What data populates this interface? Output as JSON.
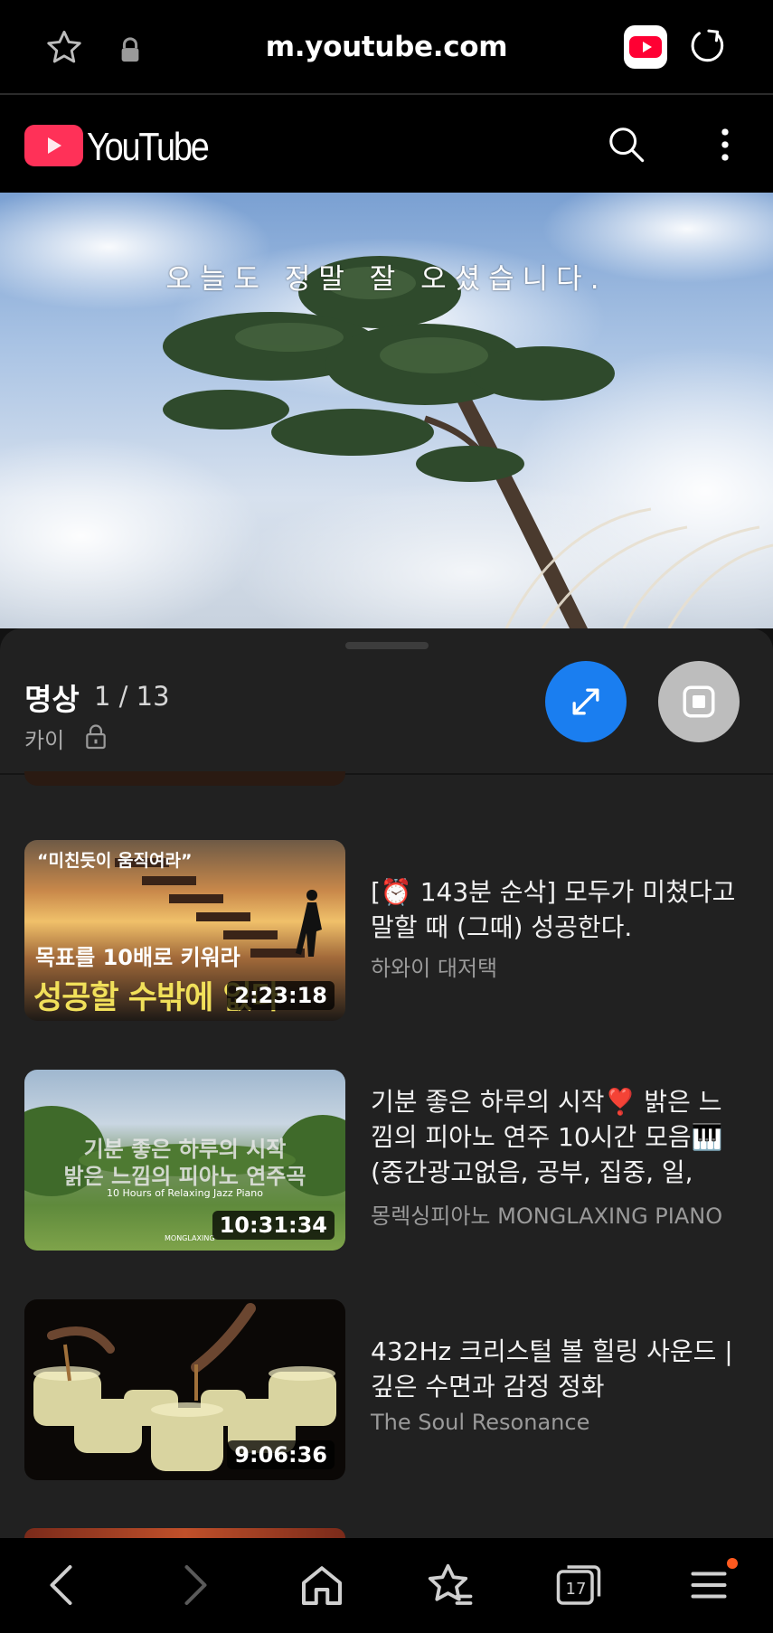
{
  "browser": {
    "url": "m.youtube.com",
    "tab_count": "17"
  },
  "youtube": {
    "wordmark": "YouTube"
  },
  "video": {
    "caption": "오늘도 정말 잘 오셨습니다."
  },
  "playlist": {
    "title": "명상",
    "position": "1 / 13",
    "owner": "카이",
    "items": [
      {
        "title": "[⏰ 143분 순삭] 모두가 미쳤다고 말할 때 (그때) 성공한다.",
        "channel": "하와이 대저택",
        "duration": "2:23:18",
        "thumb_text_top": "“미친듯이 움직여라”",
        "thumb_text_mid": "목표를 10배로 키워라",
        "thumb_text_big": "성공할 수밖에 없다"
      },
      {
        "title": "기분 좋은 하루의 시작❣️ 밝은 느낌의 피아노 연주 10시간 모음🎹 (중간광고없음, 공부, 집중, 일, 힐…",
        "channel": "몽렉싱피아노 MONGLAXING PIANO",
        "duration": "10:31:34",
        "thumb_text_top": "기분 좋은 하루의 시작",
        "thumb_text_mid": "밝은 느낌의 피아노 연주곡",
        "thumb_text_small": "10 Hours of Relaxing Jazz Piano",
        "thumb_brand": "MONGLAXING"
      },
      {
        "title": "432Hz 크리스털 볼 힐링 사운드 | 깊은 수면과 감정 정화",
        "channel": "The Soul Resonance",
        "duration": "9:06:36"
      }
    ]
  },
  "colors": {
    "accent_blue": "#1a7ef0",
    "yt_red": "#ff3158",
    "notification_dot": "#ff5a1f"
  }
}
